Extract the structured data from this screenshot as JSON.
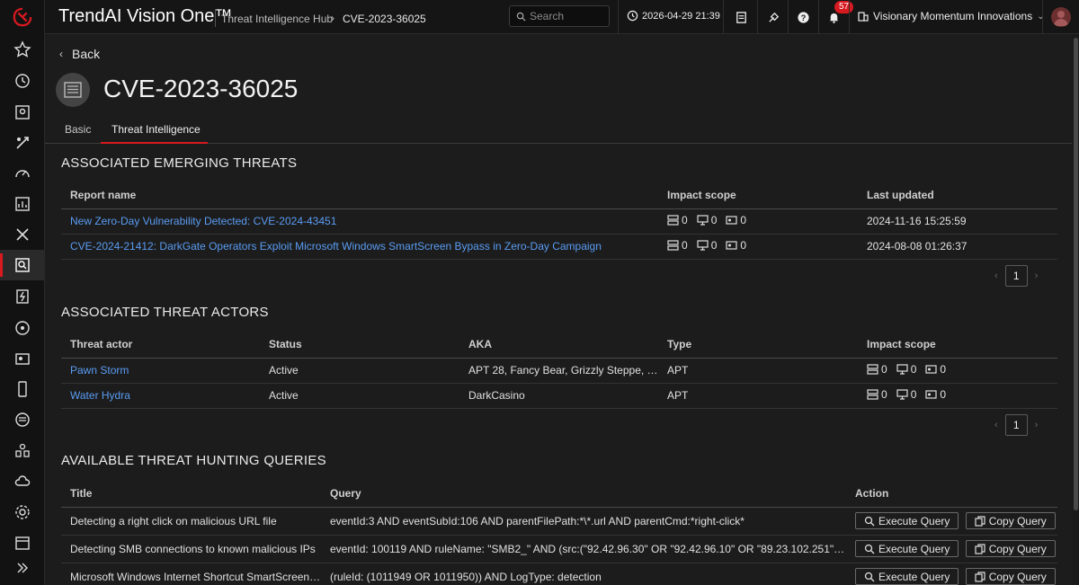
{
  "app": {
    "brand": "TrendAI Vision One™",
    "breadcrumb": [
      "Threat Intelligence Hub",
      "CVE-2023-36025"
    ],
    "search_placeholder": "Search",
    "datetime": "2026-04-29 21:39",
    "notification_count": "57",
    "organization": "Visionary Momentum Innovations"
  },
  "nav": {
    "back_label": "Back",
    "rail_items": [
      "dashboard-icon",
      "favorites-icon",
      "history-icon",
      "risk-map-icon",
      "attack-surface-icon",
      "speed-gauge-icon",
      "reports-icon",
      "xdr-icon",
      "threat-intelligence-icon",
      "zero-trust-icon",
      "network-icon",
      "identity-icon",
      "mobile-icon",
      "email-icon",
      "workflow-icon",
      "cloud-icon",
      "settings-icon",
      "apps-icon",
      "expand-icon"
    ]
  },
  "page": {
    "title": "CVE-2023-36025",
    "tabs": [
      {
        "label": "Basic",
        "active": false
      },
      {
        "label": "Threat Intelligence",
        "active": true
      }
    ]
  },
  "emerging_threats": {
    "title": "ASSOCIATED EMERGING THREATS",
    "columns": [
      "Report name",
      "Impact scope",
      "Last updated"
    ],
    "rows": [
      {
        "name": "New Zero-Day Vulnerability Detected: CVE-2024-43451",
        "servers": "0",
        "desktops": "0",
        "accounts": "0",
        "updated": "2024-11-16 15:25:59"
      },
      {
        "name": "CVE-2024-21412: DarkGate Operators Exploit Microsoft Windows SmartScreen Bypass in Zero-Day Campaign",
        "servers": "0",
        "desktops": "0",
        "accounts": "0",
        "updated": "2024-08-08 01:26:37"
      }
    ],
    "page": "1"
  },
  "threat_actors": {
    "title": "ASSOCIATED THREAT ACTORS",
    "columns": [
      "Threat actor",
      "Status",
      "AKA",
      "Type",
      "Impact scope"
    ],
    "rows": [
      {
        "name": "Pawn Storm",
        "status": "Active",
        "aka": "APT 28, Fancy Bear, Grizzly Steppe, G...",
        "type": "APT",
        "servers": "0",
        "desktops": "0",
        "accounts": "0"
      },
      {
        "name": "Water Hydra",
        "status": "Active",
        "aka": "DarkCasino",
        "type": "APT",
        "servers": "0",
        "desktops": "0",
        "accounts": "0"
      }
    ],
    "page": "1"
  },
  "hunting_queries": {
    "title": "AVAILABLE THREAT HUNTING QUERIES",
    "columns": [
      "Title",
      "Query",
      "Action"
    ],
    "execute_label": "Execute Query",
    "copy_label": "Copy Query",
    "rows": [
      {
        "title": "Detecting a right click on malicious URL file",
        "query": "eventId:3 AND eventSubId:106 AND parentFilePath:*\\*.url AND parentCmd:*right-click*"
      },
      {
        "title": "Detecting SMB connections to known malicious IPs",
        "query": "eventId: 100119 AND ruleName: \"SMB2_\" AND (src:(\"92.42.96.30\" OR \"92.42.96.10\" OR \"89.23.102.251\" OR \"..."
      },
      {
        "title": "Microsoft Windows Internet Shortcut SmartScreen ...",
        "query": "(ruleId: (1011949 OR 1011950)) AND LogType: detection"
      }
    ]
  },
  "colors": {
    "accent": "#d71920",
    "link": "#5a9cf3"
  }
}
